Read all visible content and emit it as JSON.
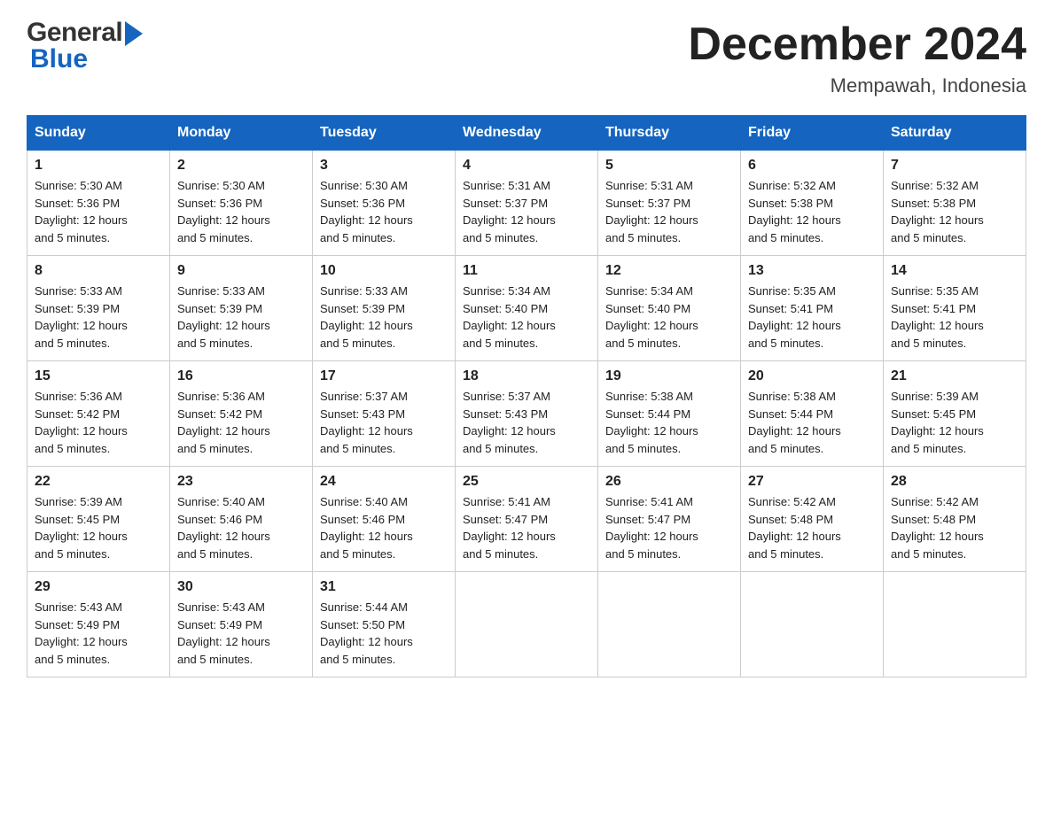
{
  "header": {
    "title": "December 2024",
    "subtitle": "Mempawah, Indonesia"
  },
  "logo": {
    "general": "General",
    "blue": "Blue"
  },
  "days_of_week": [
    "Sunday",
    "Monday",
    "Tuesday",
    "Wednesday",
    "Thursday",
    "Friday",
    "Saturday"
  ],
  "weeks": [
    [
      {
        "day": "1",
        "sunrise": "5:30 AM",
        "sunset": "5:36 PM",
        "daylight": "12 hours and 5 minutes."
      },
      {
        "day": "2",
        "sunrise": "5:30 AM",
        "sunset": "5:36 PM",
        "daylight": "12 hours and 5 minutes."
      },
      {
        "day": "3",
        "sunrise": "5:30 AM",
        "sunset": "5:36 PM",
        "daylight": "12 hours and 5 minutes."
      },
      {
        "day": "4",
        "sunrise": "5:31 AM",
        "sunset": "5:37 PM",
        "daylight": "12 hours and 5 minutes."
      },
      {
        "day": "5",
        "sunrise": "5:31 AM",
        "sunset": "5:37 PM",
        "daylight": "12 hours and 5 minutes."
      },
      {
        "day": "6",
        "sunrise": "5:32 AM",
        "sunset": "5:38 PM",
        "daylight": "12 hours and 5 minutes."
      },
      {
        "day": "7",
        "sunrise": "5:32 AM",
        "sunset": "5:38 PM",
        "daylight": "12 hours and 5 minutes."
      }
    ],
    [
      {
        "day": "8",
        "sunrise": "5:33 AM",
        "sunset": "5:39 PM",
        "daylight": "12 hours and 5 minutes."
      },
      {
        "day": "9",
        "sunrise": "5:33 AM",
        "sunset": "5:39 PM",
        "daylight": "12 hours and 5 minutes."
      },
      {
        "day": "10",
        "sunrise": "5:33 AM",
        "sunset": "5:39 PM",
        "daylight": "12 hours and 5 minutes."
      },
      {
        "day": "11",
        "sunrise": "5:34 AM",
        "sunset": "5:40 PM",
        "daylight": "12 hours and 5 minutes."
      },
      {
        "day": "12",
        "sunrise": "5:34 AM",
        "sunset": "5:40 PM",
        "daylight": "12 hours and 5 minutes."
      },
      {
        "day": "13",
        "sunrise": "5:35 AM",
        "sunset": "5:41 PM",
        "daylight": "12 hours and 5 minutes."
      },
      {
        "day": "14",
        "sunrise": "5:35 AM",
        "sunset": "5:41 PM",
        "daylight": "12 hours and 5 minutes."
      }
    ],
    [
      {
        "day": "15",
        "sunrise": "5:36 AM",
        "sunset": "5:42 PM",
        "daylight": "12 hours and 5 minutes."
      },
      {
        "day": "16",
        "sunrise": "5:36 AM",
        "sunset": "5:42 PM",
        "daylight": "12 hours and 5 minutes."
      },
      {
        "day": "17",
        "sunrise": "5:37 AM",
        "sunset": "5:43 PM",
        "daylight": "12 hours and 5 minutes."
      },
      {
        "day": "18",
        "sunrise": "5:37 AM",
        "sunset": "5:43 PM",
        "daylight": "12 hours and 5 minutes."
      },
      {
        "day": "19",
        "sunrise": "5:38 AM",
        "sunset": "5:44 PM",
        "daylight": "12 hours and 5 minutes."
      },
      {
        "day": "20",
        "sunrise": "5:38 AM",
        "sunset": "5:44 PM",
        "daylight": "12 hours and 5 minutes."
      },
      {
        "day": "21",
        "sunrise": "5:39 AM",
        "sunset": "5:45 PM",
        "daylight": "12 hours and 5 minutes."
      }
    ],
    [
      {
        "day": "22",
        "sunrise": "5:39 AM",
        "sunset": "5:45 PM",
        "daylight": "12 hours and 5 minutes."
      },
      {
        "day": "23",
        "sunrise": "5:40 AM",
        "sunset": "5:46 PM",
        "daylight": "12 hours and 5 minutes."
      },
      {
        "day": "24",
        "sunrise": "5:40 AM",
        "sunset": "5:46 PM",
        "daylight": "12 hours and 5 minutes."
      },
      {
        "day": "25",
        "sunrise": "5:41 AM",
        "sunset": "5:47 PM",
        "daylight": "12 hours and 5 minutes."
      },
      {
        "day": "26",
        "sunrise": "5:41 AM",
        "sunset": "5:47 PM",
        "daylight": "12 hours and 5 minutes."
      },
      {
        "day": "27",
        "sunrise": "5:42 AM",
        "sunset": "5:48 PM",
        "daylight": "12 hours and 5 minutes."
      },
      {
        "day": "28",
        "sunrise": "5:42 AM",
        "sunset": "5:48 PM",
        "daylight": "12 hours and 5 minutes."
      }
    ],
    [
      {
        "day": "29",
        "sunrise": "5:43 AM",
        "sunset": "5:49 PM",
        "daylight": "12 hours and 5 minutes."
      },
      {
        "day": "30",
        "sunrise": "5:43 AM",
        "sunset": "5:49 PM",
        "daylight": "12 hours and 5 minutes."
      },
      {
        "day": "31",
        "sunrise": "5:44 AM",
        "sunset": "5:50 PM",
        "daylight": "12 hours and 5 minutes."
      },
      null,
      null,
      null,
      null
    ]
  ],
  "labels": {
    "sunrise": "Sunrise:",
    "sunset": "Sunset:",
    "daylight": "Daylight:"
  }
}
